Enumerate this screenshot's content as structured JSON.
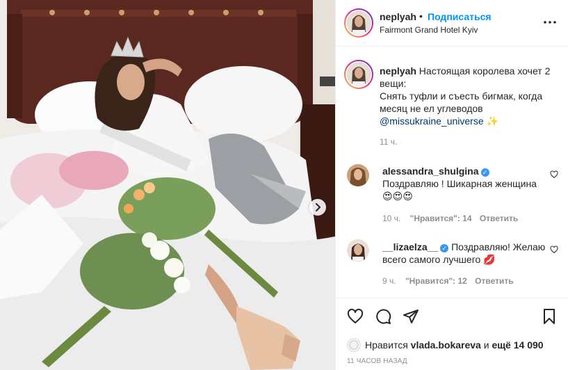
{
  "post": {
    "username": "neplyah",
    "dot": "•",
    "follow_label": "Подписаться",
    "location": "Fairmont Grand Hotel Kyiv"
  },
  "caption": {
    "username": "neplyah",
    "line1": "Настоящая королева хочет 2",
    "line2": "вещи:",
    "line3": "Снять туфли и съесть бигмак, когда",
    "line4": "месяц не ел углеводов",
    "mention": "@missukraine_universe",
    "emoji": "✨",
    "time": "11 ч."
  },
  "comments": [
    {
      "username": "alessandra_shulgina",
      "text": "Поздравляю ! Шикарная женщина",
      "emoji": "😍😍😍",
      "time": "10 ч.",
      "likes_label": "\"Нравится\": 14",
      "reply_label": "Ответить"
    },
    {
      "username": "__lizaelza__",
      "text_line1": "Поздравляю! Желаю",
      "text_line2": "всего самого лучшего",
      "emoji": "💋",
      "time": "9 ч.",
      "likes_label": "\"Нравится\": 12",
      "reply_label": "Ответить"
    }
  ],
  "likes": {
    "prefix": "Нравится",
    "user": "vlada.bokareva",
    "middle": "и",
    "more": "ещё 14 090"
  },
  "timestamp": "11 часов назад",
  "icons": {
    "more": "more-horizontal-icon",
    "like": "heart-icon",
    "comment": "comment-icon",
    "share": "paper-plane-icon",
    "save": "bookmark-icon",
    "next": "chevron-right-icon",
    "verified": "verified-badge-icon"
  },
  "colors": {
    "link_blue": "#0095f6",
    "mention_blue": "#00376b",
    "verified_blue": "#3897f0",
    "secondary_text": "#8e8e8e",
    "border": "#efefef"
  }
}
